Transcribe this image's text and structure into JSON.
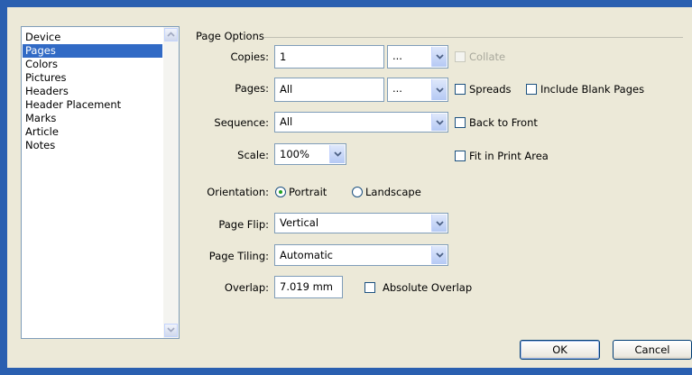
{
  "categories": {
    "items": [
      "Device",
      "Pages",
      "Colors",
      "Pictures",
      "Headers",
      "Header Placement",
      "Marks",
      "Article",
      "Notes"
    ],
    "selected": "Pages"
  },
  "page_options": {
    "group_title": "Page Options",
    "copies": {
      "label": "Copies:",
      "value": "1",
      "range_value": "..."
    },
    "collate": {
      "label": "Collate",
      "checked": false,
      "enabled": false
    },
    "pages": {
      "label": "Pages:",
      "value": "All",
      "range_value": "..."
    },
    "spreads": {
      "label": "Spreads",
      "checked": false
    },
    "include_blank_pages": {
      "label": "Include Blank Pages",
      "checked": false
    },
    "sequence": {
      "label": "Sequence:",
      "value": "All"
    },
    "back_to_front": {
      "label": "Back to Front",
      "checked": false
    },
    "scale": {
      "label": "Scale:",
      "value": "100%"
    },
    "fit_in_print_area": {
      "label": "Fit in Print Area",
      "checked": false
    },
    "orientation": {
      "label": "Orientation:",
      "portrait": "Portrait",
      "landscape": "Landscape",
      "selected": "Portrait"
    },
    "page_flip": {
      "label": "Page Flip:",
      "value": "Vertical"
    },
    "page_tiling": {
      "label": "Page Tiling:",
      "value": "Automatic"
    },
    "overlap": {
      "label": "Overlap:",
      "value": "7.019 mm"
    },
    "absolute_overlap": {
      "label": "Absolute Overlap",
      "checked": false
    }
  },
  "buttons": {
    "ok": "OK",
    "cancel": "Cancel"
  },
  "colors": {
    "selection": "#316ac5",
    "dialog_bg": "#ece9d8",
    "frame": "#2a5fb0"
  },
  "icons": {
    "dropdown": "chevron-down-icon",
    "scroll_up": "scroll-up-icon",
    "scroll_down": "scroll-down-icon"
  }
}
